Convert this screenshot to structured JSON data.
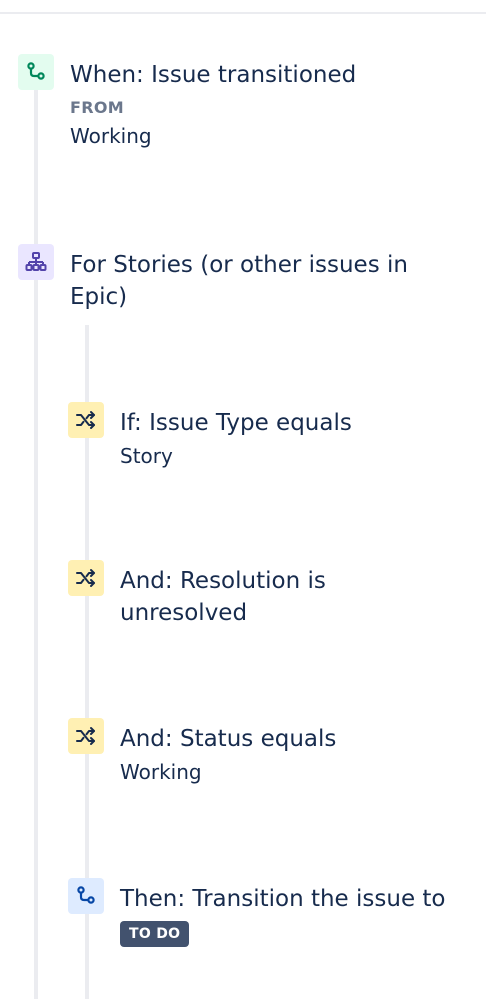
{
  "trigger": {
    "icon": "workflow-transition-icon",
    "title": "When: Issue transitioned",
    "from_label": "FROM",
    "from_value": "Working"
  },
  "branch": {
    "icon": "hierarchy-icon",
    "title": "For Stories (or other issues in Epic)"
  },
  "conditions": [
    {
      "icon": "shuffle-icon",
      "title": "If: Issue Type equals",
      "value": "Story"
    },
    {
      "icon": "shuffle-icon",
      "title": "And: Resolution is unresolved",
      "value": ""
    },
    {
      "icon": "shuffle-icon",
      "title": "And: Status equals",
      "value": "Working"
    }
  ],
  "action": {
    "icon": "workflow-transition-icon",
    "title": "Then: Transition the issue to",
    "status_lozenge": "TO DO"
  },
  "colors": {
    "trigger_bg": "#e3fcef",
    "trigger_fg": "#00875a",
    "branch_bg": "#eae6ff",
    "branch_fg": "#5243aa",
    "condition_bg": "#fff0b3",
    "condition_fg": "#172b4d",
    "action_bg": "#deebff",
    "action_fg": "#0747a6",
    "lozenge_bg": "#42526e",
    "rail": "#ebecf0"
  }
}
